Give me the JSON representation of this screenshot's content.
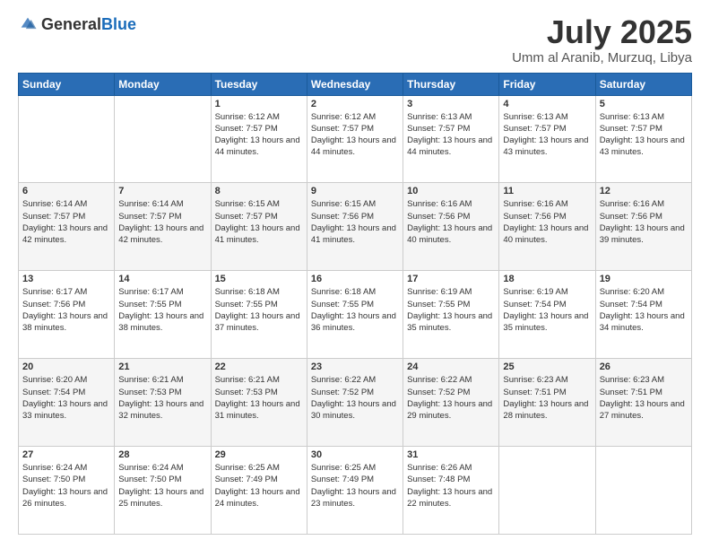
{
  "header": {
    "logo_general": "General",
    "logo_blue": "Blue",
    "month": "July 2025",
    "location": "Umm al Aranib, Murzuq, Libya"
  },
  "weekdays": [
    "Sunday",
    "Monday",
    "Tuesday",
    "Wednesday",
    "Thursday",
    "Friday",
    "Saturday"
  ],
  "weeks": [
    [
      {
        "day": "",
        "info": ""
      },
      {
        "day": "",
        "info": ""
      },
      {
        "day": "1",
        "info": "Sunrise: 6:12 AM\nSunset: 7:57 PM\nDaylight: 13 hours and 44 minutes."
      },
      {
        "day": "2",
        "info": "Sunrise: 6:12 AM\nSunset: 7:57 PM\nDaylight: 13 hours and 44 minutes."
      },
      {
        "day": "3",
        "info": "Sunrise: 6:13 AM\nSunset: 7:57 PM\nDaylight: 13 hours and 44 minutes."
      },
      {
        "day": "4",
        "info": "Sunrise: 6:13 AM\nSunset: 7:57 PM\nDaylight: 13 hours and 43 minutes."
      },
      {
        "day": "5",
        "info": "Sunrise: 6:13 AM\nSunset: 7:57 PM\nDaylight: 13 hours and 43 minutes."
      }
    ],
    [
      {
        "day": "6",
        "info": "Sunrise: 6:14 AM\nSunset: 7:57 PM\nDaylight: 13 hours and 42 minutes."
      },
      {
        "day": "7",
        "info": "Sunrise: 6:14 AM\nSunset: 7:57 PM\nDaylight: 13 hours and 42 minutes."
      },
      {
        "day": "8",
        "info": "Sunrise: 6:15 AM\nSunset: 7:57 PM\nDaylight: 13 hours and 41 minutes."
      },
      {
        "day": "9",
        "info": "Sunrise: 6:15 AM\nSunset: 7:56 PM\nDaylight: 13 hours and 41 minutes."
      },
      {
        "day": "10",
        "info": "Sunrise: 6:16 AM\nSunset: 7:56 PM\nDaylight: 13 hours and 40 minutes."
      },
      {
        "day": "11",
        "info": "Sunrise: 6:16 AM\nSunset: 7:56 PM\nDaylight: 13 hours and 40 minutes."
      },
      {
        "day": "12",
        "info": "Sunrise: 6:16 AM\nSunset: 7:56 PM\nDaylight: 13 hours and 39 minutes."
      }
    ],
    [
      {
        "day": "13",
        "info": "Sunrise: 6:17 AM\nSunset: 7:56 PM\nDaylight: 13 hours and 38 minutes."
      },
      {
        "day": "14",
        "info": "Sunrise: 6:17 AM\nSunset: 7:55 PM\nDaylight: 13 hours and 38 minutes."
      },
      {
        "day": "15",
        "info": "Sunrise: 6:18 AM\nSunset: 7:55 PM\nDaylight: 13 hours and 37 minutes."
      },
      {
        "day": "16",
        "info": "Sunrise: 6:18 AM\nSunset: 7:55 PM\nDaylight: 13 hours and 36 minutes."
      },
      {
        "day": "17",
        "info": "Sunrise: 6:19 AM\nSunset: 7:55 PM\nDaylight: 13 hours and 35 minutes."
      },
      {
        "day": "18",
        "info": "Sunrise: 6:19 AM\nSunset: 7:54 PM\nDaylight: 13 hours and 35 minutes."
      },
      {
        "day": "19",
        "info": "Sunrise: 6:20 AM\nSunset: 7:54 PM\nDaylight: 13 hours and 34 minutes."
      }
    ],
    [
      {
        "day": "20",
        "info": "Sunrise: 6:20 AM\nSunset: 7:54 PM\nDaylight: 13 hours and 33 minutes."
      },
      {
        "day": "21",
        "info": "Sunrise: 6:21 AM\nSunset: 7:53 PM\nDaylight: 13 hours and 32 minutes."
      },
      {
        "day": "22",
        "info": "Sunrise: 6:21 AM\nSunset: 7:53 PM\nDaylight: 13 hours and 31 minutes."
      },
      {
        "day": "23",
        "info": "Sunrise: 6:22 AM\nSunset: 7:52 PM\nDaylight: 13 hours and 30 minutes."
      },
      {
        "day": "24",
        "info": "Sunrise: 6:22 AM\nSunset: 7:52 PM\nDaylight: 13 hours and 29 minutes."
      },
      {
        "day": "25",
        "info": "Sunrise: 6:23 AM\nSunset: 7:51 PM\nDaylight: 13 hours and 28 minutes."
      },
      {
        "day": "26",
        "info": "Sunrise: 6:23 AM\nSunset: 7:51 PM\nDaylight: 13 hours and 27 minutes."
      }
    ],
    [
      {
        "day": "27",
        "info": "Sunrise: 6:24 AM\nSunset: 7:50 PM\nDaylight: 13 hours and 26 minutes."
      },
      {
        "day": "28",
        "info": "Sunrise: 6:24 AM\nSunset: 7:50 PM\nDaylight: 13 hours and 25 minutes."
      },
      {
        "day": "29",
        "info": "Sunrise: 6:25 AM\nSunset: 7:49 PM\nDaylight: 13 hours and 24 minutes."
      },
      {
        "day": "30",
        "info": "Sunrise: 6:25 AM\nSunset: 7:49 PM\nDaylight: 13 hours and 23 minutes."
      },
      {
        "day": "31",
        "info": "Sunrise: 6:26 AM\nSunset: 7:48 PM\nDaylight: 13 hours and 22 minutes."
      },
      {
        "day": "",
        "info": ""
      },
      {
        "day": "",
        "info": ""
      }
    ]
  ]
}
